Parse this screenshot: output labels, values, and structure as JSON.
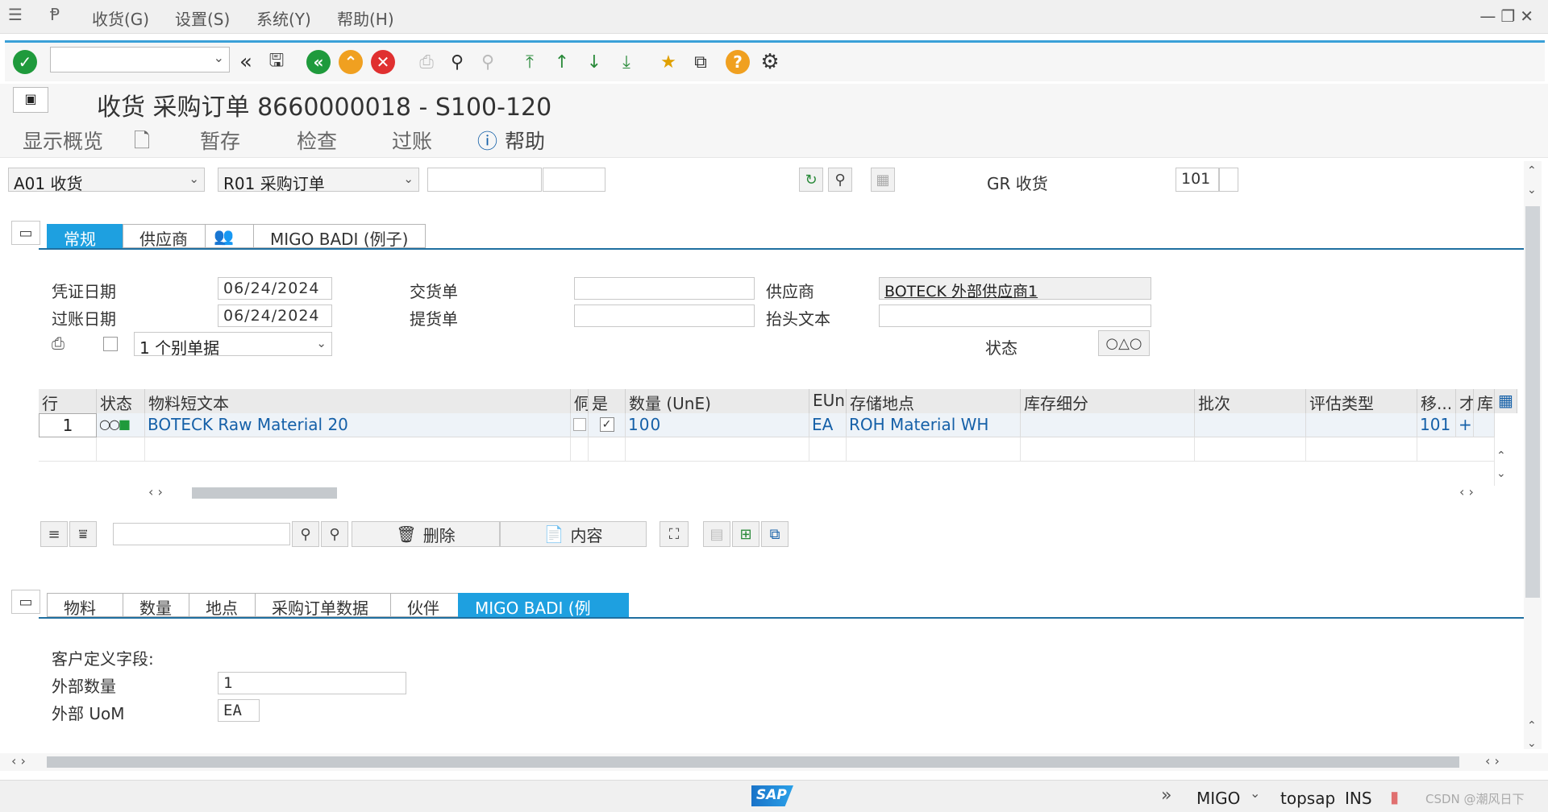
{
  "menu": {
    "receive": "收货(G)",
    "settings": "设置(S)",
    "system": "系统(Y)",
    "help": "帮助(H)"
  },
  "title": "收货 采购订单 8660000018 - S100-120",
  "appbar": {
    "overview": "显示概览",
    "hold": "暂存",
    "check": "检查",
    "post": "过账",
    "help": "帮助"
  },
  "header": {
    "transaction": "A01 收货",
    "reference": "R01 采购订单",
    "gr_label": "GR 收货",
    "movement_type": "101"
  },
  "tabs_top": [
    "常规",
    "供应商",
    "MIGO BADI (例子)"
  ],
  "general": {
    "doc_date_label": "凭证日期",
    "doc_date": "06/24/2024",
    "post_date_label": "过账日期",
    "post_date": "06/24/2024",
    "delivery_note_label": "交货单",
    "bill_of_lading_label": "提货单",
    "vendor_label": "供应商",
    "vendor": "BOTECK 外部供应商1",
    "header_text_label": "抬头文本",
    "status_label": "状态",
    "print_option": "1 个别单据"
  },
  "grid": {
    "columns": [
      "行",
      "状态",
      "物料短文本",
      "侗",
      "是",
      "数量 (UnE)",
      "EUn",
      "存储地点",
      "库存细分",
      "批次",
      "评估类型",
      "移...",
      "才",
      "库"
    ],
    "rows": [
      {
        "line": "1",
        "text": "BOTECK Raw Material 20",
        "qty": "100",
        "uom": "EA",
        "sloc": "ROH Material WH",
        "mvt": "101",
        "plus": "+"
      }
    ]
  },
  "grid_buttons": {
    "delete": "删除",
    "contents": "内容"
  },
  "tabs_bottom": [
    "物料",
    "数量",
    "地点",
    "采购订单数据",
    "伙伴",
    "MIGO BADI (例子)"
  ],
  "badi": {
    "section_label": "客户定义字段:",
    "ext_qty_label": "外部数量",
    "ext_qty": "1",
    "ext_uom_label": "外部 UoM",
    "ext_uom": "EA"
  },
  "status": {
    "tcode": "MIGO",
    "system": "topsap",
    "mode": "INS",
    "watermark": "CSDN @潮风日下"
  },
  "colors": {
    "accent": "#1ea0e0",
    "ok_green": "#1f9a3c",
    "cancel_red": "#e03030",
    "warn_orange": "#f0a020"
  }
}
